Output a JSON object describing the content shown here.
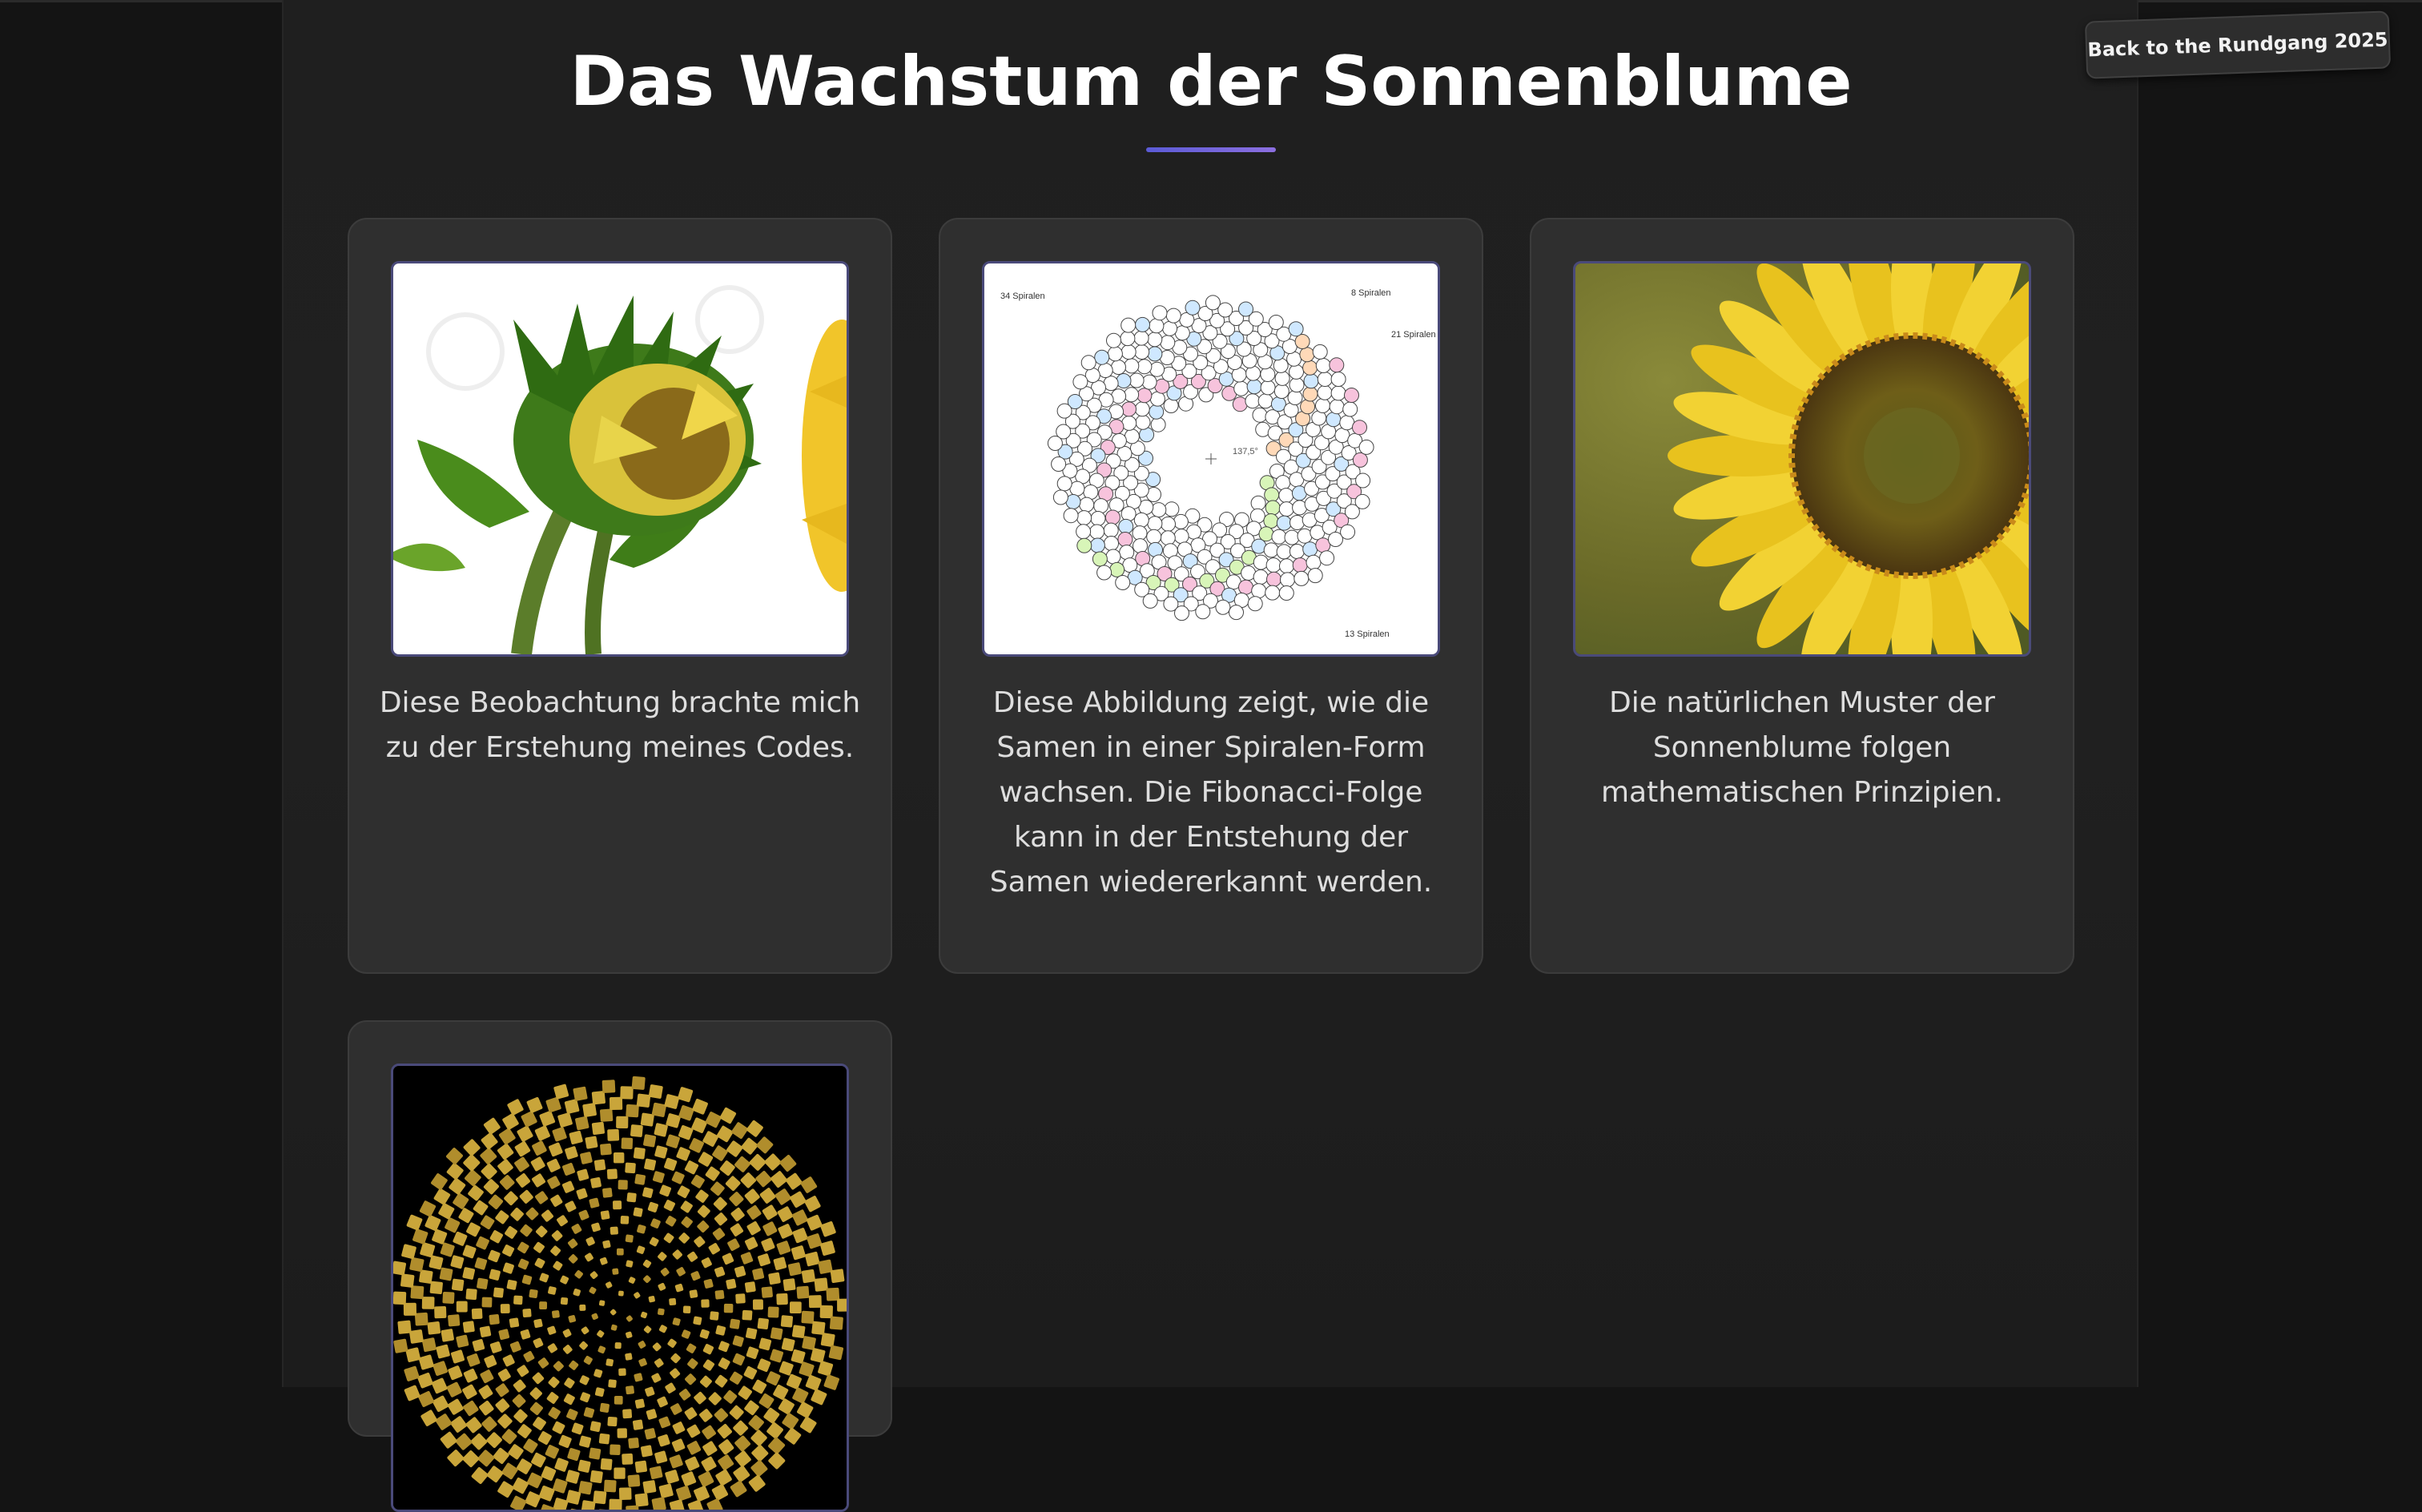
{
  "page": {
    "title": "Das Wachstum der Sonnenblume",
    "back_button_label": "Back to the Rundgang 2025"
  },
  "gallery": {
    "items": [
      {
        "caption": "Diese Beobachtung brachte mich zu der Erstehung meines Codes."
      },
      {
        "caption": "Diese Abbildung zeigt, wie die Samen in einer Spiralen-Form wachsen. Die Fibonacci-Folge kann in der Entstehung der Samen wiedererkannt werden.",
        "diagram_labels": [
          "34 Spiralen",
          "8 Spiralen",
          "21 Spiralen",
          "13 Spiralen",
          "137,5°"
        ]
      },
      {
        "caption": "Die natürlichen Muster der Sonnenblume folgen mathematischen Prinzipien."
      },
      {
        "caption": ""
      }
    ]
  },
  "colors": {
    "background": "#141414",
    "panel": "#1f1f1f",
    "card": "#2f2f2f",
    "accent": "#6a5fd8"
  }
}
